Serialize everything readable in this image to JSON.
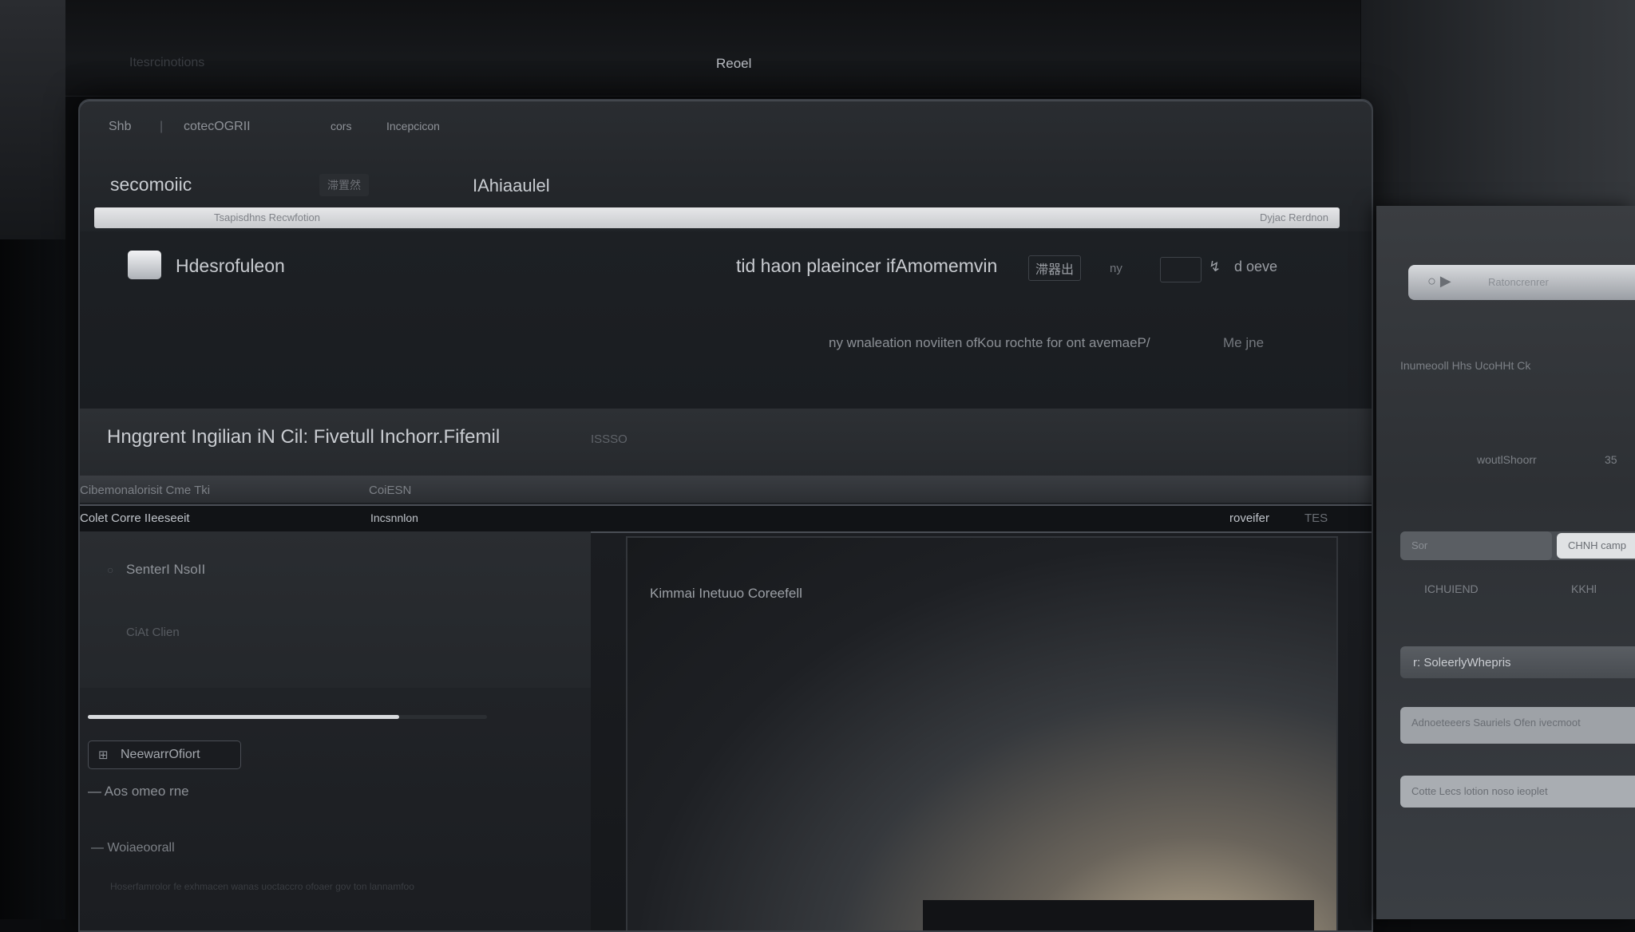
{
  "topbar": {
    "left_label": "Itesrcinotions",
    "center_label": "Reoel"
  },
  "tabs": [
    {
      "label": "Shb"
    },
    {
      "label": "|"
    },
    {
      "label": "cotecOGRII"
    },
    {
      "label": "cors"
    },
    {
      "label": "Incepcicon"
    }
  ],
  "app": {
    "title": "secomoiic",
    "badge": "滞置然",
    "subtitle": "IAhiaaulel"
  },
  "address": {
    "text": "Tsapisdhns Recwfotion",
    "right": "Dyjac Rerdnon"
  },
  "toolbar": {
    "section_name": "Hdesrofuleon",
    "search_text": "tid haon plaeincer ifAmomemvin",
    "search_chip": "滞器出",
    "tool_label": "ny",
    "tool_action": "d oeve",
    "notice_text": "ny wnaleation noviiten ofKou rochte for ont avemaeP/",
    "notice_link": "Me jne"
  },
  "headline": {
    "text": "Hnggrent Ingilian iN Cil: Fivetull Inchorr.Fifemil",
    "tag": "ISSSO"
  },
  "subhead": {
    "left": "Cibemonalorisit Cme Tki",
    "middle": "CoiESN"
  },
  "columns": {
    "left": "Colet Corre IIeeseeit",
    "middle": "Incsnnlon",
    "right": "roveifer",
    "far_right": "TES"
  },
  "left_panel": {
    "nav": [
      {
        "label": "SenterI NsoII"
      },
      {
        "label": "CiAt Clien"
      }
    ],
    "progress": 0.78,
    "new_button": {
      "icon": "plus-square-icon",
      "label": "NeewarrOfiort"
    },
    "list": [
      {
        "label": "Aos omeo rne"
      },
      {
        "label": "Woiaeoorall"
      }
    ],
    "footnote": "Hoserfamrolor fe exhmacen wanas uoctaccro ofoaer gov ton lannamfoo"
  },
  "preview": {
    "title": "Kimmai Inetuuo Coreefell"
  },
  "side_panel": {
    "pill_text": "Ratoncrenrer",
    "rows": [
      "Inumeooll Hhs UcoHHt Ck",
      "woutlShoorr",
      "35",
      "ICHUIEND",
      "KKHl"
    ],
    "tab_a": "Sor",
    "tab_b": "CHNH camp",
    "button": "r: SoleerlyWhepris",
    "card_1": "Adnoeteeers Sauriels Ofen ivecmoot",
    "card_2": "Cotte Lecs lotion noso ieoplet"
  },
  "colors": {
    "accent": "#d8dadd",
    "background": "#0b0c0e",
    "panel": "#1f2226"
  }
}
